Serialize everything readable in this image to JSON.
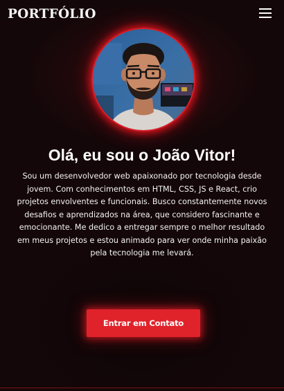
{
  "navbar": {
    "logo": "PORTFÓLIO",
    "menu_icon": "hamburger-menu-icon"
  },
  "hero": {
    "avatar_alt": "profile-photo",
    "title": "Olá, eu sou o João Vitor!",
    "description": "Sou um desenvolvedor web apaixonado por tecnologia desde jovem. Com conhecimentos em HTML, CSS, JS e React, crio projetos envolventes e funcionais. Busco constantemente novos desafios e aprendizados na área, que considero fascinante e emocionante. Me dedico a entregar sempre o melhor resultado em meus projetos e estou animado para ver onde minha paixão pela tecnologia me levará.",
    "cta_label": "Entrar em Contato"
  },
  "colors": {
    "background": "#140709",
    "accent": "#e0232b",
    "text": "#ffffff"
  }
}
